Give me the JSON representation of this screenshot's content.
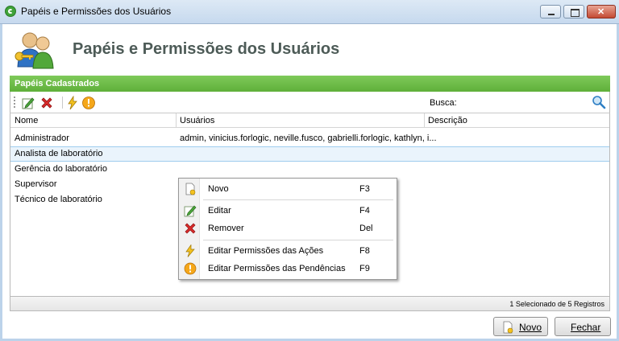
{
  "window": {
    "title": "Papéis e Permissões dos Usuários"
  },
  "header": {
    "heading": "Papéis e Permissões dos Usuários"
  },
  "panel": {
    "title": "Papéis Cadastrados",
    "search_label": "Busca:",
    "search_value": ""
  },
  "toolbar": {
    "icons": [
      "edit-icon",
      "remove-icon",
      "permissions-actions-icon",
      "permissions-pending-icon",
      "search-icon"
    ]
  },
  "grid": {
    "columns": [
      "Nome",
      "Usuários",
      "Descrição"
    ],
    "rows": [
      {
        "name": "Administrador",
        "users": "admin, vinicius.forlogic, neville.fusco, gabrielli.forlogic, kathlyn, i...",
        "description": ""
      },
      {
        "name": "Analista de laboratório",
        "users": "",
        "description": ""
      },
      {
        "name": "Gerência do laboratório",
        "users": "",
        "description": ""
      },
      {
        "name": "Supervisor",
        "users": "",
        "description": ""
      },
      {
        "name": "Técnico de laboratório",
        "users": "",
        "description": ""
      }
    ],
    "selected_index": 1,
    "status": "1 Selecionado de 5 Registros"
  },
  "context_menu": {
    "items": [
      {
        "label": "Novo",
        "shortcut": "F3",
        "icon": "new-icon"
      },
      {
        "label": "Editar",
        "shortcut": "F4",
        "icon": "edit-icon"
      },
      {
        "label": "Remover",
        "shortcut": "Del",
        "icon": "remove-icon"
      },
      {
        "label": "Editar Permissões das Ações",
        "shortcut": "F8",
        "icon": "lightning-icon"
      },
      {
        "label": "Editar Permissões das Pendências",
        "shortcut": "F9",
        "icon": "warning-icon"
      }
    ]
  },
  "footer": {
    "new_label": "Novo",
    "close_label": "Fechar"
  },
  "colors": {
    "panel_green": "#6ebd48",
    "heading_text": "#4d5b57",
    "selection": "#eaf4fc"
  }
}
